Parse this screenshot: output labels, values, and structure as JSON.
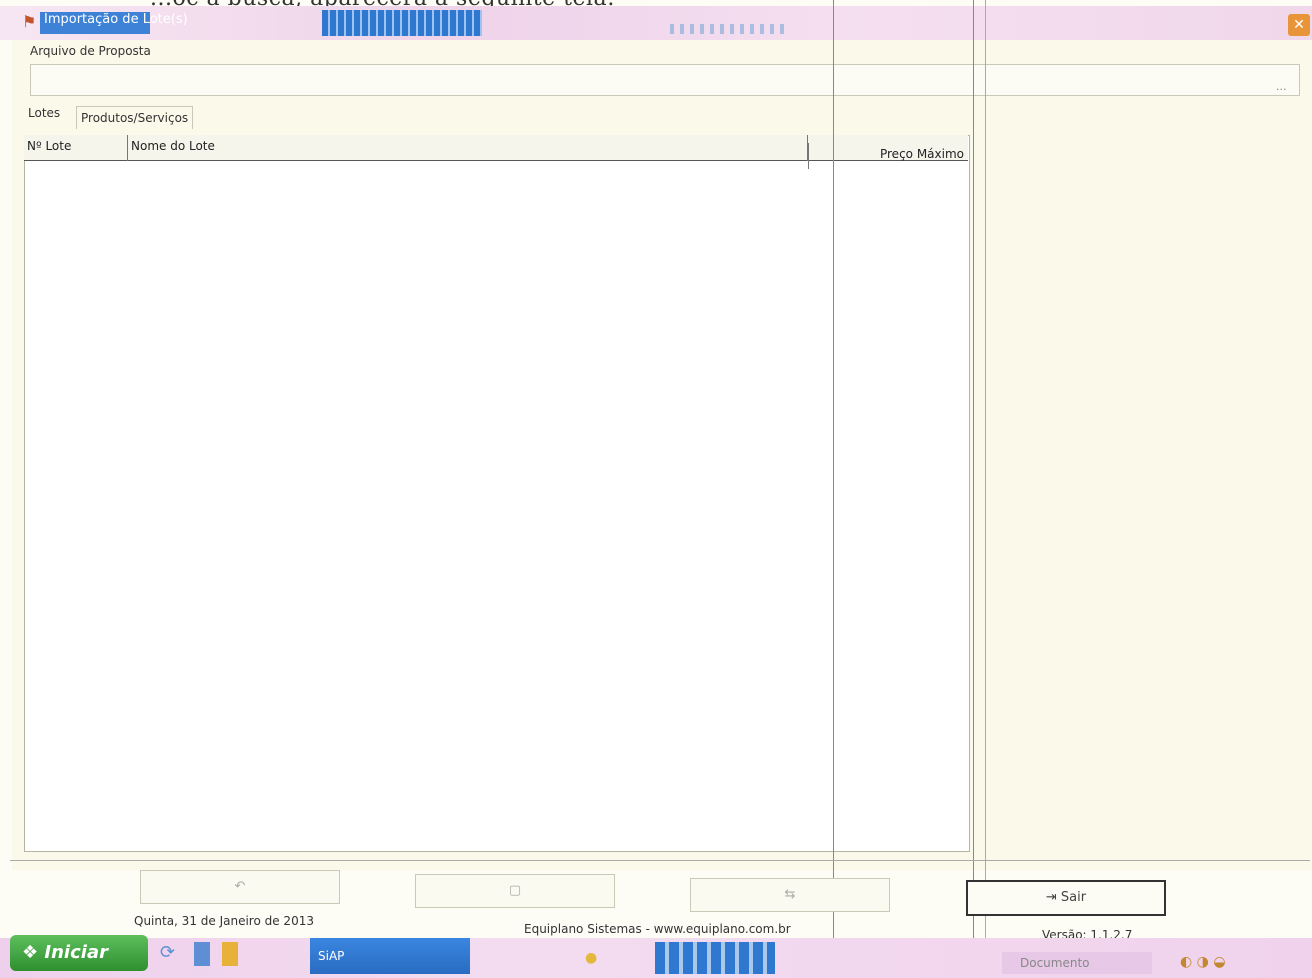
{
  "scan_text": "...oc a busca, aparecerá a seguinte tela:",
  "window": {
    "title": "Importação de Lote(s)",
    "close_glyph": "✕"
  },
  "file": {
    "label": "Arquivo de Proposta",
    "value": "",
    "browse_glyph": "..."
  },
  "tabs": [
    {
      "label": "Lotes"
    },
    {
      "label": "Produtos/Serviços"
    }
  ],
  "grid": {
    "columns": [
      "Nº Lote",
      "Nome do Lote",
      "Preço Máximo"
    ],
    "rows": []
  },
  "buttons": {
    "btn1": "↶",
    "btn2": "▢",
    "btn3": "⇆",
    "sair": "Sair"
  },
  "status": {
    "date": "Quinta, 31 de Janeiro de 2013",
    "site": "Equiplano Sistemas - www.equiplano.com.br",
    "version": "Versão: 1.1.2.7"
  },
  "taskbar": {
    "start": "Iniciar",
    "app": "SiAP",
    "task_item": "Documento"
  },
  "icons": [
    "window-icon",
    "close-icon",
    "browse-icon",
    "undo-icon",
    "clear-icon",
    "import-icon",
    "exit-icon",
    "start-icon",
    "tray-icon"
  ]
}
